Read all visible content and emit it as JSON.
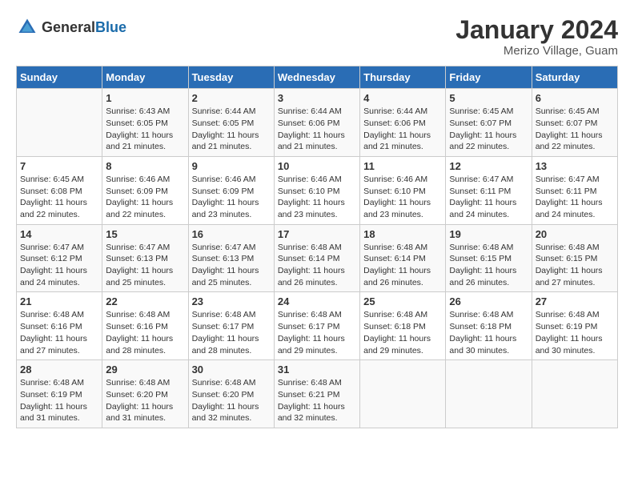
{
  "header": {
    "logo_general": "General",
    "logo_blue": "Blue",
    "month": "January 2024",
    "location": "Merizo Village, Guam"
  },
  "weekdays": [
    "Sunday",
    "Monday",
    "Tuesday",
    "Wednesday",
    "Thursday",
    "Friday",
    "Saturday"
  ],
  "weeks": [
    [
      {
        "day": "",
        "sunrise": "",
        "sunset": "",
        "daylight": ""
      },
      {
        "day": "1",
        "sunrise": "Sunrise: 6:43 AM",
        "sunset": "Sunset: 6:05 PM",
        "daylight": "Daylight: 11 hours and 21 minutes."
      },
      {
        "day": "2",
        "sunrise": "Sunrise: 6:44 AM",
        "sunset": "Sunset: 6:05 PM",
        "daylight": "Daylight: 11 hours and 21 minutes."
      },
      {
        "day": "3",
        "sunrise": "Sunrise: 6:44 AM",
        "sunset": "Sunset: 6:06 PM",
        "daylight": "Daylight: 11 hours and 21 minutes."
      },
      {
        "day": "4",
        "sunrise": "Sunrise: 6:44 AM",
        "sunset": "Sunset: 6:06 PM",
        "daylight": "Daylight: 11 hours and 21 minutes."
      },
      {
        "day": "5",
        "sunrise": "Sunrise: 6:45 AM",
        "sunset": "Sunset: 6:07 PM",
        "daylight": "Daylight: 11 hours and 22 minutes."
      },
      {
        "day": "6",
        "sunrise": "Sunrise: 6:45 AM",
        "sunset": "Sunset: 6:07 PM",
        "daylight": "Daylight: 11 hours and 22 minutes."
      }
    ],
    [
      {
        "day": "7",
        "sunrise": "Sunrise: 6:45 AM",
        "sunset": "Sunset: 6:08 PM",
        "daylight": "Daylight: 11 hours and 22 minutes."
      },
      {
        "day": "8",
        "sunrise": "Sunrise: 6:46 AM",
        "sunset": "Sunset: 6:09 PM",
        "daylight": "Daylight: 11 hours and 22 minutes."
      },
      {
        "day": "9",
        "sunrise": "Sunrise: 6:46 AM",
        "sunset": "Sunset: 6:09 PM",
        "daylight": "Daylight: 11 hours and 23 minutes."
      },
      {
        "day": "10",
        "sunrise": "Sunrise: 6:46 AM",
        "sunset": "Sunset: 6:10 PM",
        "daylight": "Daylight: 11 hours and 23 minutes."
      },
      {
        "day": "11",
        "sunrise": "Sunrise: 6:46 AM",
        "sunset": "Sunset: 6:10 PM",
        "daylight": "Daylight: 11 hours and 23 minutes."
      },
      {
        "day": "12",
        "sunrise": "Sunrise: 6:47 AM",
        "sunset": "Sunset: 6:11 PM",
        "daylight": "Daylight: 11 hours and 24 minutes."
      },
      {
        "day": "13",
        "sunrise": "Sunrise: 6:47 AM",
        "sunset": "Sunset: 6:11 PM",
        "daylight": "Daylight: 11 hours and 24 minutes."
      }
    ],
    [
      {
        "day": "14",
        "sunrise": "Sunrise: 6:47 AM",
        "sunset": "Sunset: 6:12 PM",
        "daylight": "Daylight: 11 hours and 24 minutes."
      },
      {
        "day": "15",
        "sunrise": "Sunrise: 6:47 AM",
        "sunset": "Sunset: 6:13 PM",
        "daylight": "Daylight: 11 hours and 25 minutes."
      },
      {
        "day": "16",
        "sunrise": "Sunrise: 6:47 AM",
        "sunset": "Sunset: 6:13 PM",
        "daylight": "Daylight: 11 hours and 25 minutes."
      },
      {
        "day": "17",
        "sunrise": "Sunrise: 6:48 AM",
        "sunset": "Sunset: 6:14 PM",
        "daylight": "Daylight: 11 hours and 26 minutes."
      },
      {
        "day": "18",
        "sunrise": "Sunrise: 6:48 AM",
        "sunset": "Sunset: 6:14 PM",
        "daylight": "Daylight: 11 hours and 26 minutes."
      },
      {
        "day": "19",
        "sunrise": "Sunrise: 6:48 AM",
        "sunset": "Sunset: 6:15 PM",
        "daylight": "Daylight: 11 hours and 26 minutes."
      },
      {
        "day": "20",
        "sunrise": "Sunrise: 6:48 AM",
        "sunset": "Sunset: 6:15 PM",
        "daylight": "Daylight: 11 hours and 27 minutes."
      }
    ],
    [
      {
        "day": "21",
        "sunrise": "Sunrise: 6:48 AM",
        "sunset": "Sunset: 6:16 PM",
        "daylight": "Daylight: 11 hours and 27 minutes."
      },
      {
        "day": "22",
        "sunrise": "Sunrise: 6:48 AM",
        "sunset": "Sunset: 6:16 PM",
        "daylight": "Daylight: 11 hours and 28 minutes."
      },
      {
        "day": "23",
        "sunrise": "Sunrise: 6:48 AM",
        "sunset": "Sunset: 6:17 PM",
        "daylight": "Daylight: 11 hours and 28 minutes."
      },
      {
        "day": "24",
        "sunrise": "Sunrise: 6:48 AM",
        "sunset": "Sunset: 6:17 PM",
        "daylight": "Daylight: 11 hours and 29 minutes."
      },
      {
        "day": "25",
        "sunrise": "Sunrise: 6:48 AM",
        "sunset": "Sunset: 6:18 PM",
        "daylight": "Daylight: 11 hours and 29 minutes."
      },
      {
        "day": "26",
        "sunrise": "Sunrise: 6:48 AM",
        "sunset": "Sunset: 6:18 PM",
        "daylight": "Daylight: 11 hours and 30 minutes."
      },
      {
        "day": "27",
        "sunrise": "Sunrise: 6:48 AM",
        "sunset": "Sunset: 6:19 PM",
        "daylight": "Daylight: 11 hours and 30 minutes."
      }
    ],
    [
      {
        "day": "28",
        "sunrise": "Sunrise: 6:48 AM",
        "sunset": "Sunset: 6:19 PM",
        "daylight": "Daylight: 11 hours and 31 minutes."
      },
      {
        "day": "29",
        "sunrise": "Sunrise: 6:48 AM",
        "sunset": "Sunset: 6:20 PM",
        "daylight": "Daylight: 11 hours and 31 minutes."
      },
      {
        "day": "30",
        "sunrise": "Sunrise: 6:48 AM",
        "sunset": "Sunset: 6:20 PM",
        "daylight": "Daylight: 11 hours and 32 minutes."
      },
      {
        "day": "31",
        "sunrise": "Sunrise: 6:48 AM",
        "sunset": "Sunset: 6:21 PM",
        "daylight": "Daylight: 11 hours and 32 minutes."
      },
      {
        "day": "",
        "sunrise": "",
        "sunset": "",
        "daylight": ""
      },
      {
        "day": "",
        "sunrise": "",
        "sunset": "",
        "daylight": ""
      },
      {
        "day": "",
        "sunrise": "",
        "sunset": "",
        "daylight": ""
      }
    ]
  ]
}
